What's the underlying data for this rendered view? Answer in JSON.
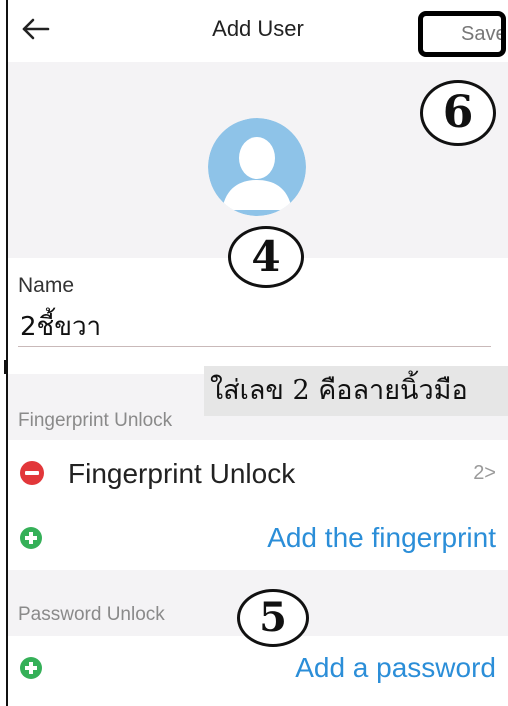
{
  "header": {
    "title": "Add User",
    "save_label": "Save",
    "back_icon": "arrow-left-icon"
  },
  "avatar": {
    "icon": "user-avatar-icon",
    "color": "#8ec3e8"
  },
  "name_field": {
    "label": "Name",
    "value": "2ชี้ขวา"
  },
  "fingerprint_section": {
    "header": "Fingerprint Unlock",
    "item_label": "Fingerprint Unlock",
    "item_count": "2>",
    "add_label": "Add the fingerprint"
  },
  "password_section": {
    "header": "Password Unlock",
    "add_label": "Add a password"
  },
  "annotations": {
    "step_save": "6",
    "step_name": "4",
    "step_password": "5",
    "note": "ใส่เลข 2 คือลายนิ้วมือ"
  },
  "colors": {
    "accent_blue": "#2b8ed8",
    "remove_red": "#e2373a",
    "add_green": "#35b058",
    "section_bg": "#f4f3f5"
  }
}
